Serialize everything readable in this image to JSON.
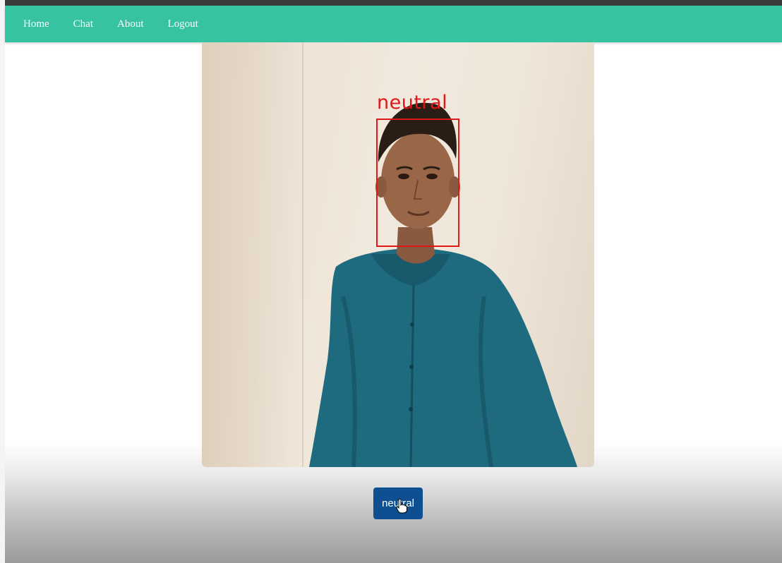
{
  "nav": {
    "items": [
      {
        "label": "Home"
      },
      {
        "label": "Chat"
      },
      {
        "label": "About"
      },
      {
        "label": "Logout"
      }
    ]
  },
  "video": {
    "detection_label": "neutral",
    "box_color": "#e01818"
  },
  "result_button": {
    "label": "neutral"
  },
  "colors": {
    "navbar": "#37c3a1",
    "button": "#0d4f91"
  },
  "icons": {
    "cursor": "hand-pointer-icon"
  }
}
